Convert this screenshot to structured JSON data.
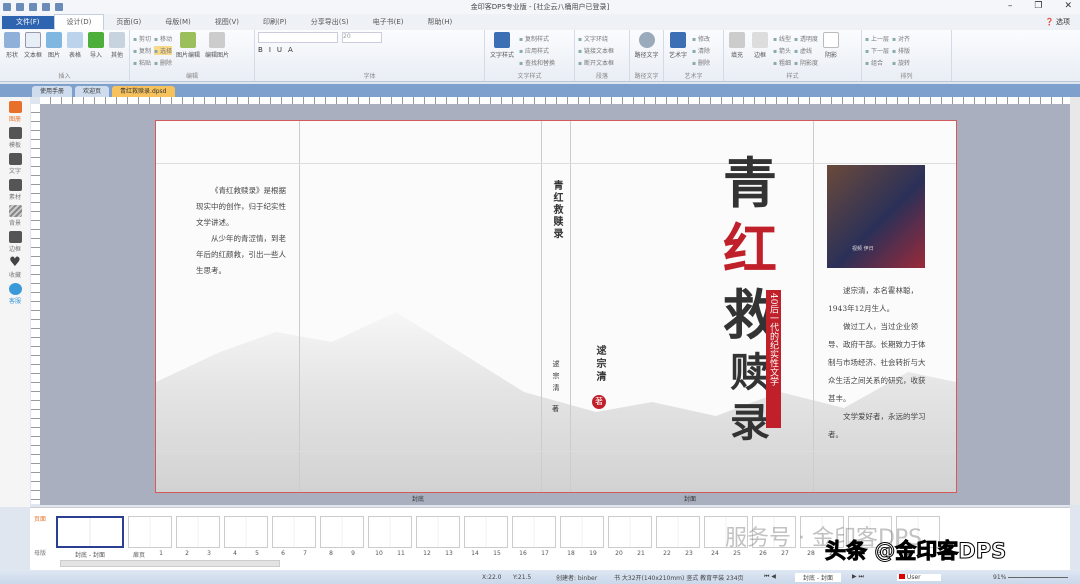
{
  "window": {
    "title": "金印客DPS专业版 - [社企云八桶用户已登录]",
    "minimize": "–",
    "restore": "❐",
    "close": "✕"
  },
  "menu": {
    "tabs": [
      "文件(F)",
      "设计(D)",
      "页面(G)",
      "母版(M)",
      "视图(V)",
      "印刷(P)",
      "分享导出(S)",
      "电子书(E)",
      "帮助(H)"
    ],
    "active": 1,
    "help": "选项"
  },
  "ribbon": {
    "groups": [
      {
        "label": "插入",
        "buttons": [
          "形状",
          "文本框",
          "图片",
          "表格",
          "导入",
          "其他"
        ]
      },
      {
        "label": "编辑",
        "small": [
          "剪切",
          "复制",
          "粘贴",
          "移动",
          "选择",
          "删除"
        ],
        "buttons": [
          "图片编辑",
          "编辑图片"
        ]
      },
      {
        "label": "字体",
        "font_size": "20",
        "small": [
          "B",
          "I",
          "U",
          "A"
        ]
      },
      {
        "label": "文字样式",
        "buttons": [
          "文字样式"
        ],
        "small": [
          "复制样式",
          "应用样式",
          "查找和替换"
        ]
      },
      {
        "label": "段落",
        "small": [
          "文字环绕",
          "链接文本框",
          "断开文本框"
        ]
      },
      {
        "label": "路径文字",
        "buttons": [
          "路径文字"
        ]
      },
      {
        "label": "艺术字",
        "buttons": [
          "艺术字"
        ],
        "small": [
          "修改",
          "清除",
          "删除"
        ]
      },
      {
        "label": "样式",
        "buttons": [
          "填充",
          "边框",
          "阴影"
        ],
        "small": [
          "线型",
          "箭头",
          "粗细",
          "透明度",
          "虚线",
          "阴影度"
        ]
      },
      {
        "label": "排列",
        "small": [
          "上一层",
          "下一层",
          "组合",
          "对齐",
          "排版",
          "旋转"
        ]
      }
    ]
  },
  "doc_tabs": [
    "使用手册",
    "欢迎页",
    "青红救赎录.dpsd"
  ],
  "doc_tab_active": 2,
  "sidebar": [
    "图册",
    "模板",
    "文字",
    "素材",
    "背景",
    "边框",
    "收藏",
    "客服"
  ],
  "page": {
    "back_blurb": [
      "《青红救赎录》是根据现实中的创作，归于纪实性文学讲述。",
      "从少年的青涩情，到老年后的红颜救，引出一些人生思考。"
    ],
    "spine_title": "青红救赎录",
    "spine_author": "逑宗清",
    "spine_seal": "著",
    "title_chars": [
      "青",
      "红",
      "救",
      "赎",
      "录"
    ],
    "subtitle": "40后一代的纪实性文学",
    "author": "逑宗清",
    "photo_caption": "视频 伊日",
    "bio": [
      "逑宗清，本名霍林聪，1943年12月生人。",
      "做过工人，当过企业领导、政府干部。长期致力于体制与市场经济、社会转折与大众生活之间关系的研究，收获甚丰。",
      "文学爱好者，永远的学习者。"
    ],
    "label_back": "封底",
    "label_front": "封面"
  },
  "thumbnails": {
    "side_tabs": [
      "页面",
      "母版"
    ],
    "labels": [
      "封底 - 封面",
      "扉页",
      "1",
      "2",
      "3",
      "4",
      "5",
      "6",
      "7",
      "8",
      "9",
      "10",
      "11",
      "12",
      "13",
      "14",
      "15",
      "16",
      "17",
      "18",
      "19",
      "20",
      "21",
      "22",
      "23",
      "24",
      "25",
      "26",
      "27",
      "28",
      "29",
      "30",
      "31",
      "32"
    ]
  },
  "watermark": {
    "service": "服务号 · 金印客DPS",
    "toutiao": "头条 @金印客DPS"
  },
  "status": {
    "x": "X:22.0",
    "y": "Y:21.5",
    "creator": "创建者: binber",
    "book": "书 大32开(140x210mm) 竖式 教育平装 234页",
    "page_select": "封底 - 封面",
    "layer": "User",
    "zoom": "91%"
  },
  "colors": {
    "accent": "#2e64b0",
    "title_red": "#c0202a"
  }
}
